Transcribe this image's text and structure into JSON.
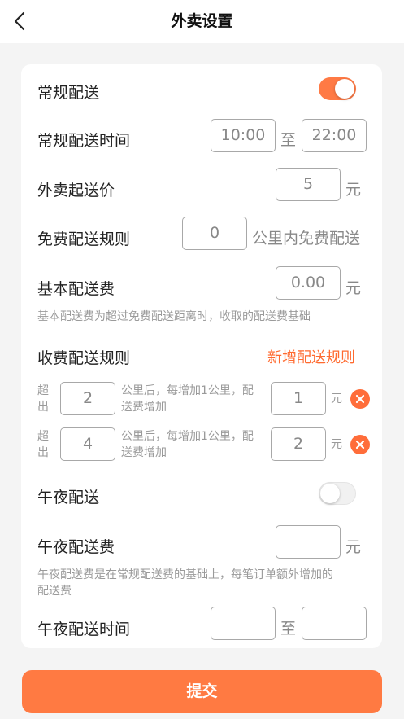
{
  "nav": {
    "title": "外卖设置"
  },
  "regular_delivery": {
    "label": "常规配送",
    "enabled": true
  },
  "regular_time": {
    "label": "常规配送时间",
    "start": "10:00",
    "separator": "至",
    "end": "22:00"
  },
  "min_order": {
    "label": "外卖起送价",
    "value": "5",
    "unit": "元"
  },
  "free_rule": {
    "label": "免费配送规则",
    "value": "0",
    "suffix": "公里内免费配送"
  },
  "base_fee": {
    "label": "基本配送费",
    "value": "0.00",
    "unit": "元",
    "hint": "基本配送费为超过免费配送距离时，收取的配送费基础"
  },
  "fee_rules": {
    "label": "收费配送规则",
    "add_label": "新增配送规则",
    "items": [
      {
        "prefix_line1": "超",
        "prefix_line2": "出",
        "distance": "2",
        "middle_line1": "公里后，每增加1公里，配",
        "middle_line2": "送费增加",
        "amount": "1",
        "unit": "元"
      },
      {
        "prefix_line1": "超",
        "prefix_line2": "出",
        "distance": "4",
        "middle_line1": "公里后，每增加1公里，配",
        "middle_line2": "送费增加",
        "amount": "2",
        "unit": "元"
      }
    ]
  },
  "night_delivery": {
    "label": "午夜配送",
    "enabled": false
  },
  "night_fee": {
    "label": "午夜配送费",
    "value": "",
    "unit": "元",
    "hint_line1": "午夜配送费是在常规配送费的基础上，每笔订单额外增加的",
    "hint_line2": "配送费"
  },
  "night_time": {
    "label": "午夜配送时间",
    "start": "",
    "separator": "至",
    "end": ""
  },
  "submit": {
    "label": "提交"
  },
  "colors": {
    "accent": "#ff7a42",
    "link": "#ff6a2f",
    "background": "#f4f4f4"
  },
  "icons": {
    "back": "chevron-left-icon",
    "delete": "close-circle-icon"
  }
}
